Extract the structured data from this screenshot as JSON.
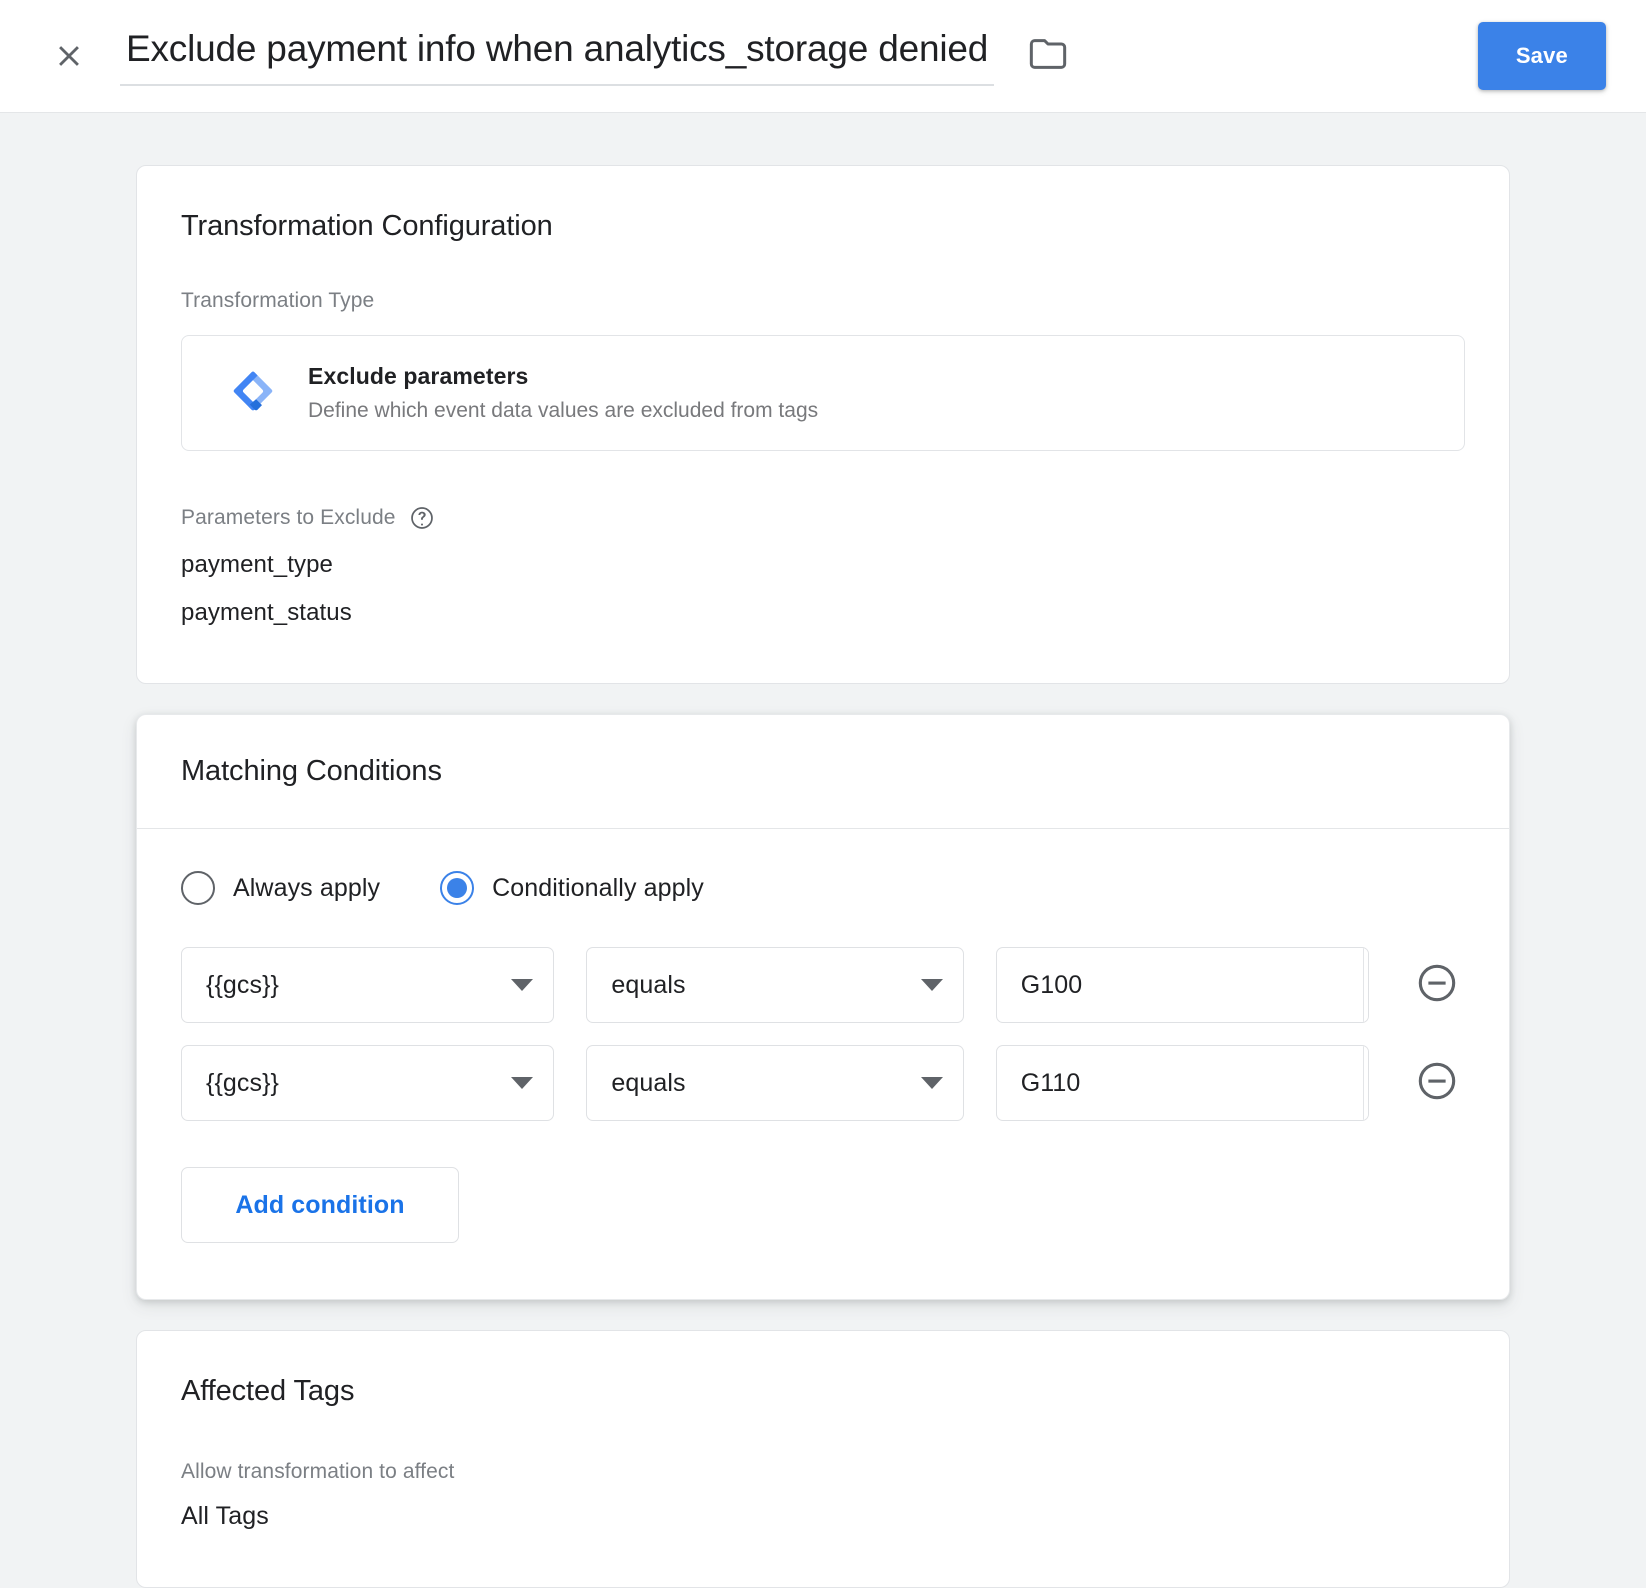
{
  "header": {
    "close_icon": "close-icon",
    "title": "Exclude payment info when analytics_storage denied",
    "folder_icon": "folder-icon",
    "save_label": "Save"
  },
  "colors": {
    "accent": "#3b82e8",
    "link": "#1a73e8",
    "page_bg": "#f1f3f4",
    "card_bg": "#ffffff",
    "muted_text": "#7b7f84",
    "text": "#202124"
  },
  "transformation_card": {
    "title": "Transformation Configuration",
    "type_label": "Transformation Type",
    "type_icon": "gtm-diamond-icon",
    "type_name": "Exclude parameters",
    "type_description": "Define which event data values are excluded from tags",
    "parameters_label": "Parameters to Exclude",
    "parameters_help_icon": "help-circle-icon",
    "parameters": [
      "payment_type",
      "payment_status"
    ]
  },
  "matching_conditions_card": {
    "title": "Matching Conditions",
    "apply_mode_options": [
      {
        "label": "Always apply",
        "selected": false
      },
      {
        "label": "Conditionally apply",
        "selected": true
      }
    ],
    "conditions": [
      {
        "variable": "{{gcs}}",
        "operator": "equals",
        "value": "G100",
        "value_placeholder": "",
        "variable_picker_icon": "lego-brick-plus-icon",
        "remove_icon": "minus-circle-icon"
      },
      {
        "variable": "{{gcs}}",
        "operator": "equals",
        "value": "G110",
        "value_placeholder": "",
        "variable_picker_icon": "lego-brick-plus-icon",
        "remove_icon": "minus-circle-icon"
      }
    ],
    "add_condition_label": "Add condition"
  },
  "affected_tags_card": {
    "title": "Affected Tags",
    "allow_label": "Allow transformation to affect",
    "allow_value": "All Tags"
  }
}
